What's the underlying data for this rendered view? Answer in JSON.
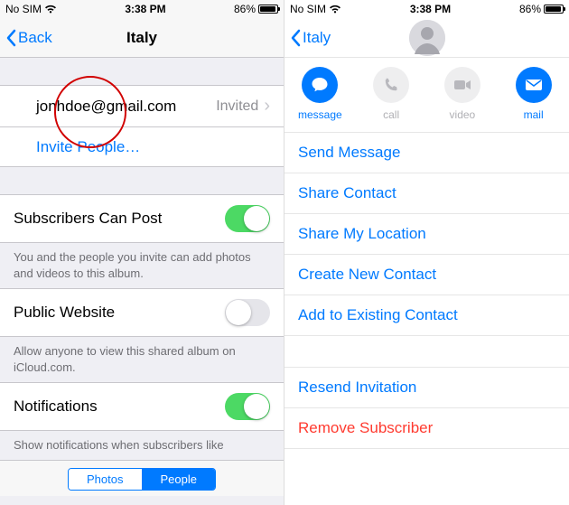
{
  "status": {
    "carrier": "No SIM",
    "wifi": "wifi-icon",
    "time": "3:38 PM",
    "battery_pct": "86%"
  },
  "left": {
    "back_label": "Back",
    "title": "Italy",
    "subscriber_email": "jonhdoe@gmail.com",
    "subscriber_status": "Invited",
    "invite_label": "Invite People…",
    "post_label": "Subscribers Can Post",
    "post_on": true,
    "post_footer": "You and the people you invite can add photos and videos to this album.",
    "public_label": "Public Website",
    "public_on": false,
    "public_footer": "Allow anyone to view this shared album on iCloud.com.",
    "notif_label": "Notifications",
    "notif_on": true,
    "notif_footer": "Show notifications when subscribers like",
    "seg": {
      "a": "Photos",
      "b": "People"
    }
  },
  "right": {
    "back_label": "Italy",
    "actions": {
      "message": "message",
      "call": "call",
      "video": "video",
      "mail": "mail"
    },
    "items": {
      "send_message": "Send Message",
      "share_contact": "Share Contact",
      "share_location": "Share My Location",
      "create_contact": "Create New Contact",
      "add_existing": "Add to Existing Contact",
      "resend": "Resend Invitation",
      "remove": "Remove Subscriber"
    }
  }
}
